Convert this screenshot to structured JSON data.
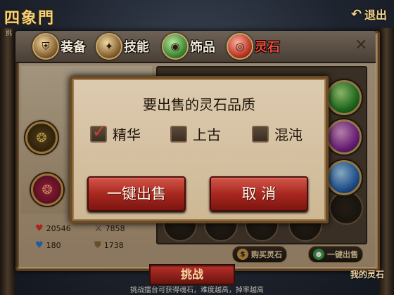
{
  "header": {
    "logo_text": "四象門",
    "logo_sub": "挑",
    "exit_label": "退出"
  },
  "tabs": [
    {
      "label": "装备",
      "icon": "armor-icon",
      "active": false
    },
    {
      "label": "技能",
      "icon": "skill-icon",
      "active": false
    },
    {
      "label": "饰品",
      "icon": "accessory-icon",
      "active": false
    },
    {
      "label": "灵石",
      "icon": "spirit-stone-icon",
      "active": true
    }
  ],
  "stats": {
    "hp": "20546",
    "attack": "7858",
    "mana": "180",
    "defense": "1738"
  },
  "buttons": {
    "buy_stone": "购买灵石",
    "sell_all": "一键出售",
    "my_stones": "我的灵石",
    "challenge": "挑战"
  },
  "hint": "挑战擂台可获得魂石，难度越高，掉率越高",
  "dialog": {
    "title": "要出售的灵石品质",
    "options": [
      {
        "label": "精华",
        "checked": true
      },
      {
        "label": "上古",
        "checked": false
      },
      {
        "label": "混沌",
        "checked": false
      }
    ],
    "confirm_label": "一键出售",
    "cancel_label": "取 消"
  },
  "colors": {
    "accent_red": "#a82820",
    "gold": "#c99a48",
    "panel_bg": "#cdb89a"
  }
}
